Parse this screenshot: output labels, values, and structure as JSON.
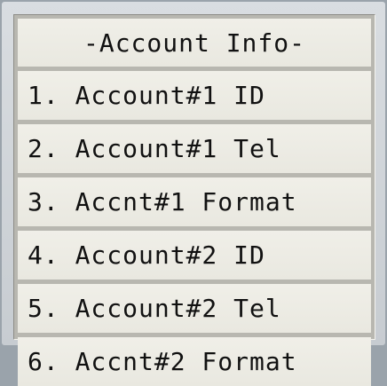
{
  "menu": {
    "title": "-Account Info-",
    "items": [
      {
        "label": "1. Account#1 ID"
      },
      {
        "label": "2. Account#1 Tel"
      },
      {
        "label": "3. Accnt#1 Format"
      },
      {
        "label": "4. Account#2 ID"
      },
      {
        "label": "5. Account#2 Tel"
      },
      {
        "label": "6. Accnt#2 Format"
      }
    ]
  },
  "colors": {
    "row_background": "#f0efe8",
    "panel_background": "#b8b7b0",
    "frame_background": "#d9dde1",
    "text": "#111111"
  }
}
